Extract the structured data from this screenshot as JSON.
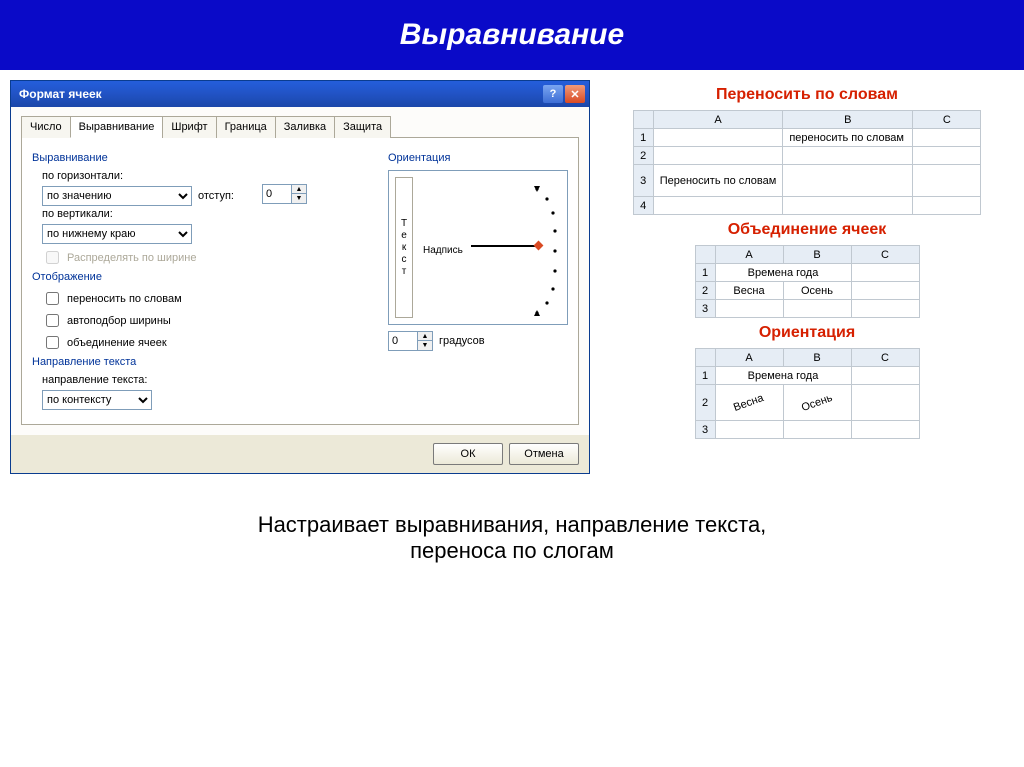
{
  "slide": {
    "title": "Выравнивание",
    "caption_line1": "Настраивает выравнивания, направление текста,",
    "caption_line2": "переноса по слогам"
  },
  "dialog": {
    "title": "Формат ячеек",
    "tabs": [
      "Число",
      "Выравнивание",
      "Шрифт",
      "Граница",
      "Заливка",
      "Защита"
    ],
    "active_tab": 1,
    "sections": {
      "alignment": {
        "label": "Выравнивание",
        "horiz_label": "по горизонтали:",
        "horiz_value": "по значению",
        "indent_label": "отступ:",
        "indent_value": "0",
        "vert_label": "по вертикали:",
        "vert_value": "по нижнему краю",
        "justify_label": "Распределять по ширине"
      },
      "display": {
        "label": "Отображение",
        "wrap": "переносить по словам",
        "shrink": "автоподбор ширины",
        "merge": "объединение ячеек"
      },
      "direction": {
        "label": "Направление текста",
        "sublabel": "направление текста:",
        "value": "по контексту"
      },
      "orientation": {
        "label": "Ориентация",
        "vertical_text": "Текст",
        "caption": "Надпись",
        "degrees_value": "0",
        "degrees_unit": "градусов"
      }
    },
    "buttons": {
      "ok": "ОК",
      "cancel": "Отмена"
    }
  },
  "examples": {
    "wrap": {
      "title": "Переносить по словам",
      "cols": [
        "A",
        "B",
        "C"
      ],
      "rows": [
        "1",
        "2",
        "3",
        "4"
      ],
      "b1": "переносить по словам",
      "a3": "Переносить по словам"
    },
    "merge": {
      "title": "Объединение ячеек",
      "cols": [
        "A",
        "B",
        "C"
      ],
      "rows": [
        "1",
        "2",
        "3"
      ],
      "merged": "Времена года",
      "a2": "Весна",
      "b2": "Осень"
    },
    "orient": {
      "title": "Ориентация",
      "cols": [
        "A",
        "B",
        "C"
      ],
      "rows": [
        "1",
        "2",
        "3"
      ],
      "merged": "Времена года",
      "a2": "Весна",
      "b2": "Осень"
    }
  }
}
